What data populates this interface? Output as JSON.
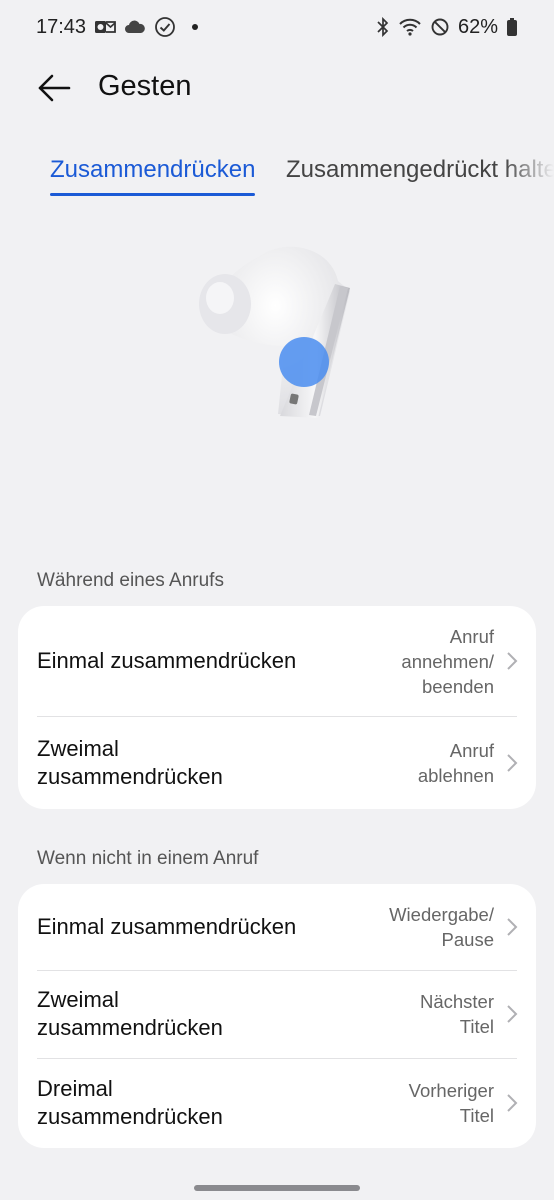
{
  "status_bar": {
    "time": "17:43",
    "battery_percent": "62%",
    "left_icons": [
      "outlook-icon",
      "cloud-icon",
      "check-circle-icon",
      "dot-icon"
    ],
    "right_icons": [
      "bluetooth-icon",
      "wifi-icon",
      "do-not-disturb-icon",
      "battery-icon"
    ]
  },
  "header": {
    "title": "Gesten",
    "back_icon": "arrow-left-icon"
  },
  "tabs": [
    {
      "label": "Zusammendrücken",
      "active": true
    },
    {
      "label": "Zusammengedrückt halten",
      "active": false
    }
  ],
  "colors": {
    "accent": "#1b5ad6",
    "background": "#f1f1f3",
    "card": "#ffffff",
    "highlight": "#4a8df0"
  },
  "sections": [
    {
      "header": "Während eines Anrufs",
      "rows": [
        {
          "label": "Einmal zusammendrücken",
          "value": "Anruf annehmen/ beenden"
        },
        {
          "label": "Zweimal zusammendrücken",
          "value": "Anruf ablehnen"
        }
      ]
    },
    {
      "header": "Wenn nicht in einem Anruf",
      "rows": [
        {
          "label": "Einmal zusammendrücken",
          "value": "Wiedergabe/ Pause"
        },
        {
          "label": "Zweimal zusammendrücken",
          "value": "Nächster Titel"
        },
        {
          "label": "Dreimal zusammendrücken",
          "value": "Vorheriger Titel"
        }
      ]
    }
  ]
}
